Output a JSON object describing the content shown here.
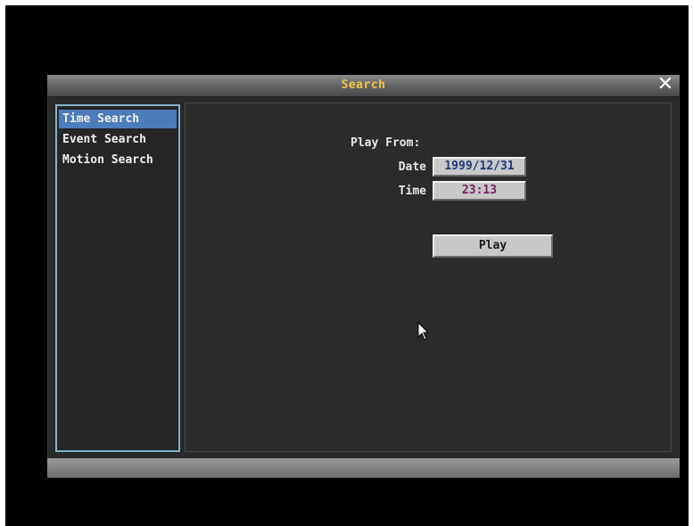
{
  "window": {
    "title": "Search",
    "close_icon": "close-icon"
  },
  "sidebar": {
    "items": [
      {
        "label": "Time Search",
        "selected": true
      },
      {
        "label": "Event Search",
        "selected": false
      },
      {
        "label": "Motion Search",
        "selected": false
      }
    ]
  },
  "main": {
    "play_from_label": "Play From:",
    "date_label": "Date",
    "date_value": "1999/12/31",
    "time_label": "Time",
    "time_value": "23:13",
    "play_button_label": "Play"
  },
  "colors": {
    "title_text": "#f4c24a",
    "selected_item_bg": "#4d7cbc",
    "sidebar_border": "#7fb2c8",
    "date_value_text": "#1c3a7c",
    "time_value_text": "#7a2060"
  },
  "cursor_icon": "mouse-pointer-icon"
}
